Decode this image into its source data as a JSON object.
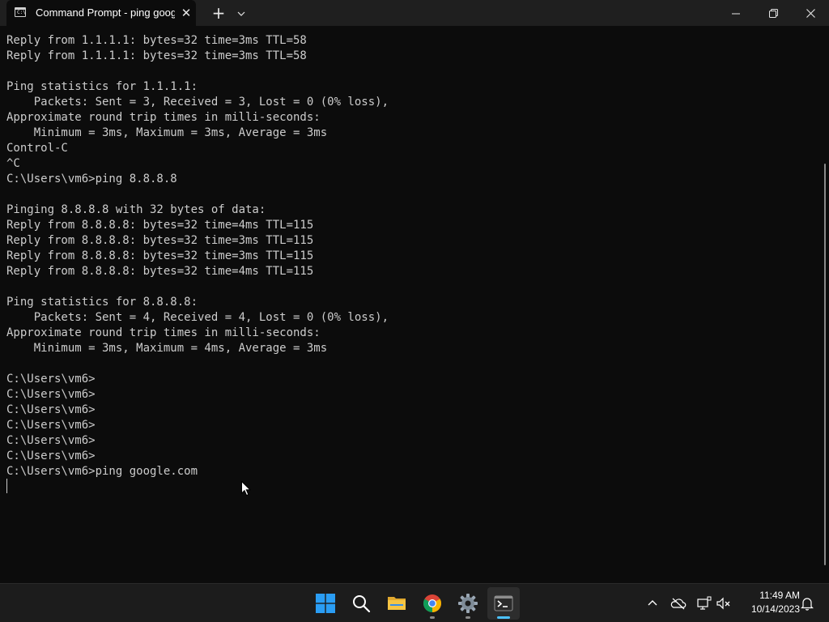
{
  "window": {
    "tab_title": "Command Prompt - ping google.com",
    "tab_icon_glyph": "C:\\",
    "tab_close_glyph": "✕",
    "new_tab_glyph": "+",
    "dropdown_glyph": "⌄",
    "minimize_glyph": "—",
    "maximize_glyph": "❐",
    "close_glyph": "✕"
  },
  "terminal": {
    "lines": [
      "Reply from 1.1.1.1: bytes=32 time=3ms TTL=58",
      "Reply from 1.1.1.1: bytes=32 time=3ms TTL=58",
      "",
      "Ping statistics for 1.1.1.1:",
      "    Packets: Sent = 3, Received = 3, Lost = 0 (0% loss),",
      "Approximate round trip times in milli-seconds:",
      "    Minimum = 3ms, Maximum = 3ms, Average = 3ms",
      "Control-C",
      "^C",
      "C:\\Users\\vm6>ping 8.8.8.8",
      "",
      "Pinging 8.8.8.8 with 32 bytes of data:",
      "Reply from 8.8.8.8: bytes=32 time=4ms TTL=115",
      "Reply from 8.8.8.8: bytes=32 time=3ms TTL=115",
      "Reply from 8.8.8.8: bytes=32 time=3ms TTL=115",
      "Reply from 8.8.8.8: bytes=32 time=4ms TTL=115",
      "",
      "Ping statistics for 8.8.8.8:",
      "    Packets: Sent = 4, Received = 4, Lost = 0 (0% loss),",
      "Approximate round trip times in milli-seconds:",
      "    Minimum = 3ms, Maximum = 4ms, Average = 3ms",
      "",
      "C:\\Users\\vm6>",
      "C:\\Users\\vm6>",
      "C:\\Users\\vm6>",
      "C:\\Users\\vm6>",
      "C:\\Users\\vm6>",
      "C:\\Users\\vm6>",
      "C:\\Users\\vm6>ping google.com"
    ]
  },
  "taskbar": {
    "apps": [
      {
        "name": "start-icon",
        "active": false,
        "running": false
      },
      {
        "name": "search-icon",
        "active": false,
        "running": false
      },
      {
        "name": "file-explorer-icon",
        "active": false,
        "running": false
      },
      {
        "name": "chrome-icon",
        "active": false,
        "running": true
      },
      {
        "name": "settings-icon",
        "active": false,
        "running": true
      },
      {
        "name": "terminal-icon",
        "active": true,
        "running": true
      }
    ],
    "tray": [
      "chevron-up-icon",
      "onedrive-offline-icon",
      "network-icon",
      "volume-muted-icon",
      "notification-bell-icon"
    ],
    "time": "11:49 AM",
    "date": "10/14/2023"
  },
  "colors": {
    "terminal_bg": "#0c0c0c",
    "terminal_fg": "#cccccc",
    "titlebar_bg": "#1f1f1f",
    "taskbar_bg": "#1c1c1c",
    "accent": "#4cc2ff"
  }
}
